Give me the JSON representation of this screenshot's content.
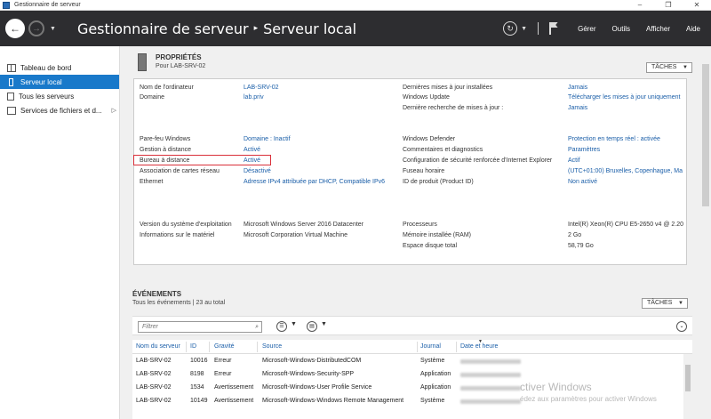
{
  "window": {
    "title": "Gestionnaire de serveur",
    "controls": [
      "–",
      "❐",
      "✕"
    ]
  },
  "header": {
    "breadcrumb_root": "Gestionnaire de serveur",
    "breadcrumb_current": "Serveur local",
    "menu": [
      "Gérer",
      "Outils",
      "Afficher",
      "Aide"
    ]
  },
  "sidebar": {
    "items": [
      {
        "label": "Tableau de bord",
        "icon": "dashboard-icon",
        "active": false
      },
      {
        "label": "Serveur local",
        "icon": "server-icon",
        "active": true
      },
      {
        "label": "Tous les serveurs",
        "icon": "servers-icon",
        "active": false
      },
      {
        "label": "Services de fichiers et d...",
        "icon": "file-services-icon",
        "active": false
      }
    ]
  },
  "properties": {
    "title": "PROPRIÉTÉS",
    "subtitle": "Pour LAB-SRV-02",
    "tasks_label": "TÂCHES",
    "left": [
      {
        "label": "Nom de l'ordinateur",
        "value": "LAB-SRV-02",
        "link": true
      },
      {
        "label": "Domaine",
        "value": "lab.priv",
        "link": true
      },
      {
        "label": "Pare-feu Windows",
        "value": "Domaine : Inactif",
        "link": true
      },
      {
        "label": "Gestion à distance",
        "value": "Activé",
        "link": true
      },
      {
        "label": "Bureau à distance",
        "value": "Activé",
        "link": true
      },
      {
        "label": "Association de cartes réseau",
        "value": "Désactivé",
        "link": true
      },
      {
        "label": "Ethernet",
        "value": "Adresse IPv4 attribuée par DHCP, Compatible IPv6",
        "link": true
      },
      {
        "label": "Version du système d'exploitation",
        "value": "Microsoft Windows Server 2016 Datacenter",
        "link": false
      },
      {
        "label": "Informations sur le matériel",
        "value": "Microsoft Corporation Virtual Machine",
        "link": false
      }
    ],
    "right": [
      {
        "label": "Dernières mises à jour installées",
        "value": "Jamais",
        "link": true
      },
      {
        "label": "Windows Update",
        "value": "Télécharger les mises à jour uniquement",
        "link": true
      },
      {
        "label": "Dernière recherche de mises à jour :",
        "value": "Jamais",
        "link": true
      },
      {
        "label": "Windows Defender",
        "value": "Protection en temps réel : activée",
        "link": true
      },
      {
        "label": "Commentaires et diagnostics",
        "value": "Paramètres",
        "link": true
      },
      {
        "label": "Configuration de sécurité renforcée d'Internet Explorer",
        "value": "Actif",
        "link": true
      },
      {
        "label": "Fuseau horaire",
        "value": "(UTC+01:00) Bruxelles, Copenhague, Ma",
        "link": true
      },
      {
        "label": "ID de produit (Product ID)",
        "value": "Non activé",
        "link": true
      },
      {
        "label": "Processeurs",
        "value": "Intel(R) Xeon(R) CPU E5-2650 v4 @ 2.20",
        "link": false
      },
      {
        "label": "Mémoire installée (RAM)",
        "value": "2 Go",
        "link": false
      },
      {
        "label": "Espace disque total",
        "value": "58,79 Go",
        "link": false
      }
    ]
  },
  "events": {
    "title": "ÉVÉNEMENTS",
    "subtitle": "Tous les événements | 23 au total",
    "tasks_label": "TÂCHES",
    "filter_placeholder": "Filtrer",
    "columns": [
      "Nom du serveur",
      "ID",
      "Gravité",
      "Source",
      "Journal",
      "Date et heure"
    ],
    "rows": [
      {
        "server": "LAB-SRV-02",
        "id": "10016",
        "severity": "Erreur",
        "source": "Microsoft-Windows-DistributedCOM",
        "log": "Système"
      },
      {
        "server": "LAB-SRV-02",
        "id": "8198",
        "severity": "Erreur",
        "source": "Microsoft-Windows-Security-SPP",
        "log": "Application"
      },
      {
        "server": "LAB-SRV-02",
        "id": "1534",
        "severity": "Avertissement",
        "source": "Microsoft-Windows-User Profile Service",
        "log": "Application"
      },
      {
        "server": "LAB-SRV-02",
        "id": "10149",
        "severity": "Avertissement",
        "source": "Microsoft-Windows-Windows Remote Management",
        "log": "Système"
      }
    ]
  },
  "watermark": {
    "line1": "ctiver Windows",
    "line2": "édez aux paramètres pour activer Windows"
  }
}
